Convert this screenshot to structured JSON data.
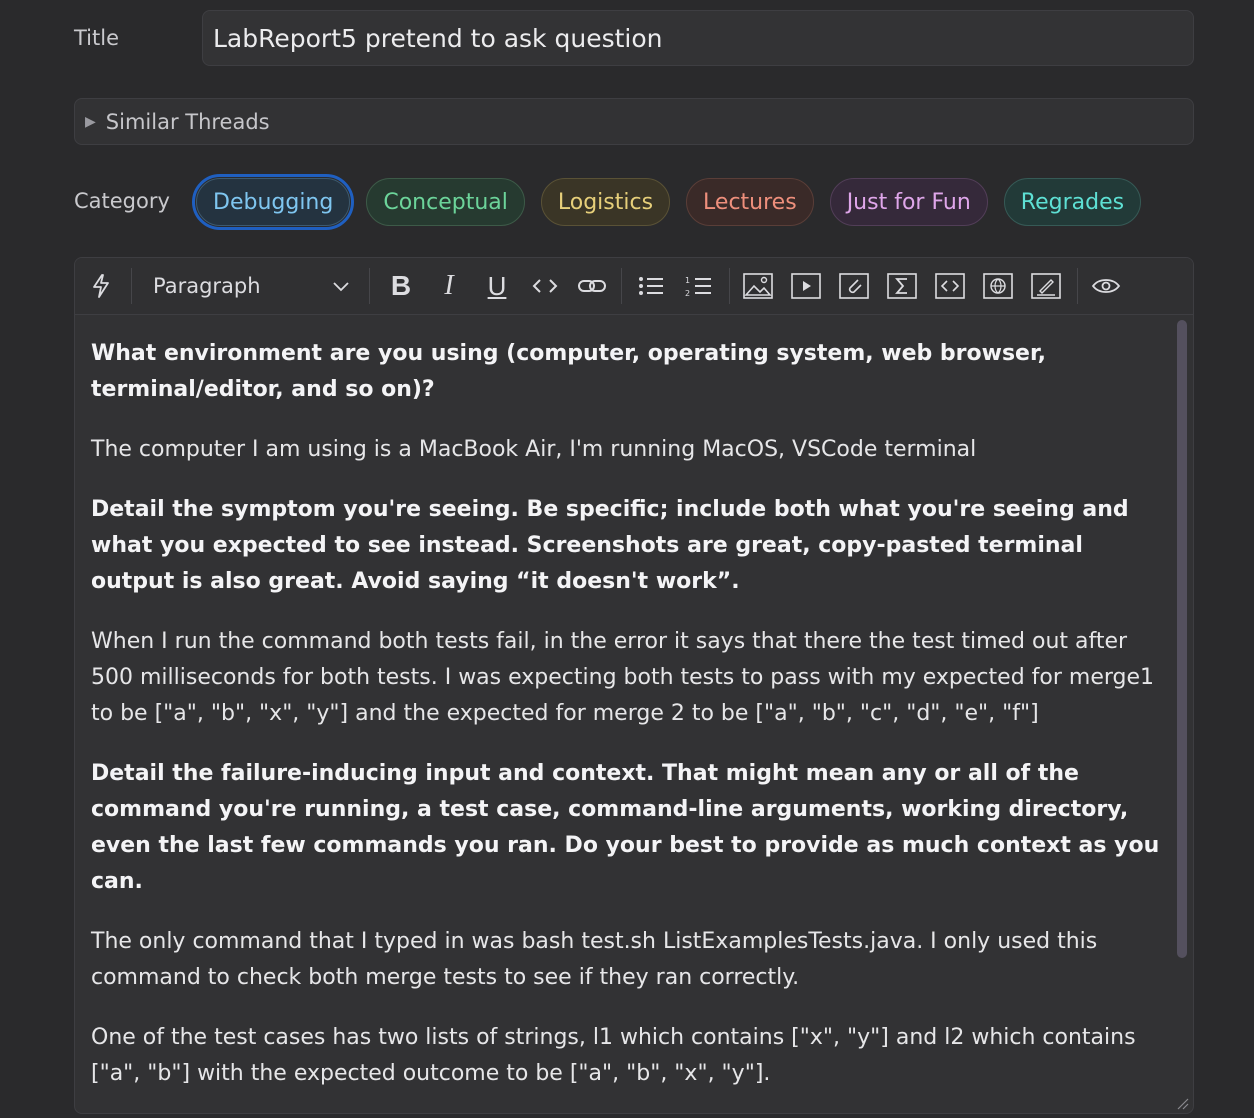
{
  "form": {
    "title_label": "Title",
    "title_value": "LabReport5 pretend to ask question",
    "similar_threads_label": "Similar Threads",
    "category_label": "Category",
    "categories": [
      {
        "label": "Debugging",
        "text_color": "#7fc6f0",
        "bg_color": "#243340",
        "border_color": "#3c5a70",
        "selected": true
      },
      {
        "label": "Conceptual",
        "text_color": "#6cd49a",
        "bg_color": "#263a30",
        "border_color": "#3d5a48",
        "selected": false
      },
      {
        "label": "Logistics",
        "text_color": "#e6cf7a",
        "bg_color": "#3a3526",
        "border_color": "#5a5236",
        "selected": false
      },
      {
        "label": "Lectures",
        "text_color": "#ee8f7c",
        "bg_color": "#3a2a28",
        "border_color": "#5a3e38",
        "selected": false
      },
      {
        "label": "Just for Fun",
        "text_color": "#dfa6ea",
        "bg_color": "#35293a",
        "border_color": "#523e58",
        "selected": false
      },
      {
        "label": "Regrades",
        "text_color": "#5ee0d4",
        "bg_color": "#223a38",
        "border_color": "#365a56",
        "selected": false
      }
    ]
  },
  "editor": {
    "toolbar": {
      "block_format": "Paragraph",
      "icons": [
        "lightning-icon",
        "bold-icon",
        "italic-icon",
        "underline-icon",
        "code-icon",
        "link-icon",
        "bullet-list-icon",
        "numbered-list-icon",
        "image-icon",
        "video-icon",
        "attachment-icon",
        "math-icon",
        "code-block-icon",
        "web-embed-icon",
        "drawing-icon",
        "preview-eye-icon"
      ]
    },
    "paragraphs": [
      {
        "bold": true,
        "text": "What environment are you using (computer, operating system, web browser, terminal/editor, and so on)?"
      },
      {
        "bold": false,
        "text": "The computer I am using is a MacBook Air, I'm running MacOS, VSCode terminal"
      },
      {
        "bold": true,
        "text": "Detail the symptom you're seeing. Be specific; include both what you're seeing and what you expected to see instead. Screenshots are great, copy-pasted terminal output is also great. Avoid saying “it doesn't work”."
      },
      {
        "bold": false,
        "text": "When I run the command both tests fail, in the error it says that there the test timed out after 500 milliseconds for both tests. I was expecting both tests to pass with my expected for merge1 to be [\"a\", \"b\", \"x\", \"y\"] and the expected for merge 2 to be [\"a\", \"b\", \"c\", \"d\", \"e\", \"f\"]"
      },
      {
        "bold": true,
        "text": "Detail the failure-inducing input and context. That might mean any or all of the command you're running, a test case, command-line arguments, working directory, even the last few commands you ran. Do your best to provide as much context as you can."
      },
      {
        "bold": false,
        "text": "The only command that I typed in was bash test.sh ListExamplesTests.java. I only used this command to check both merge tests to see if they ran correctly."
      },
      {
        "bold": false,
        "text": "One of the test cases has two lists of strings, l1 which contains [\"x\", \"y\"] and l2 which contains [\"a\", \"b\"] with the expected outcome to be [\"a\", \"b\", \"x\", \"y\"]."
      }
    ]
  }
}
